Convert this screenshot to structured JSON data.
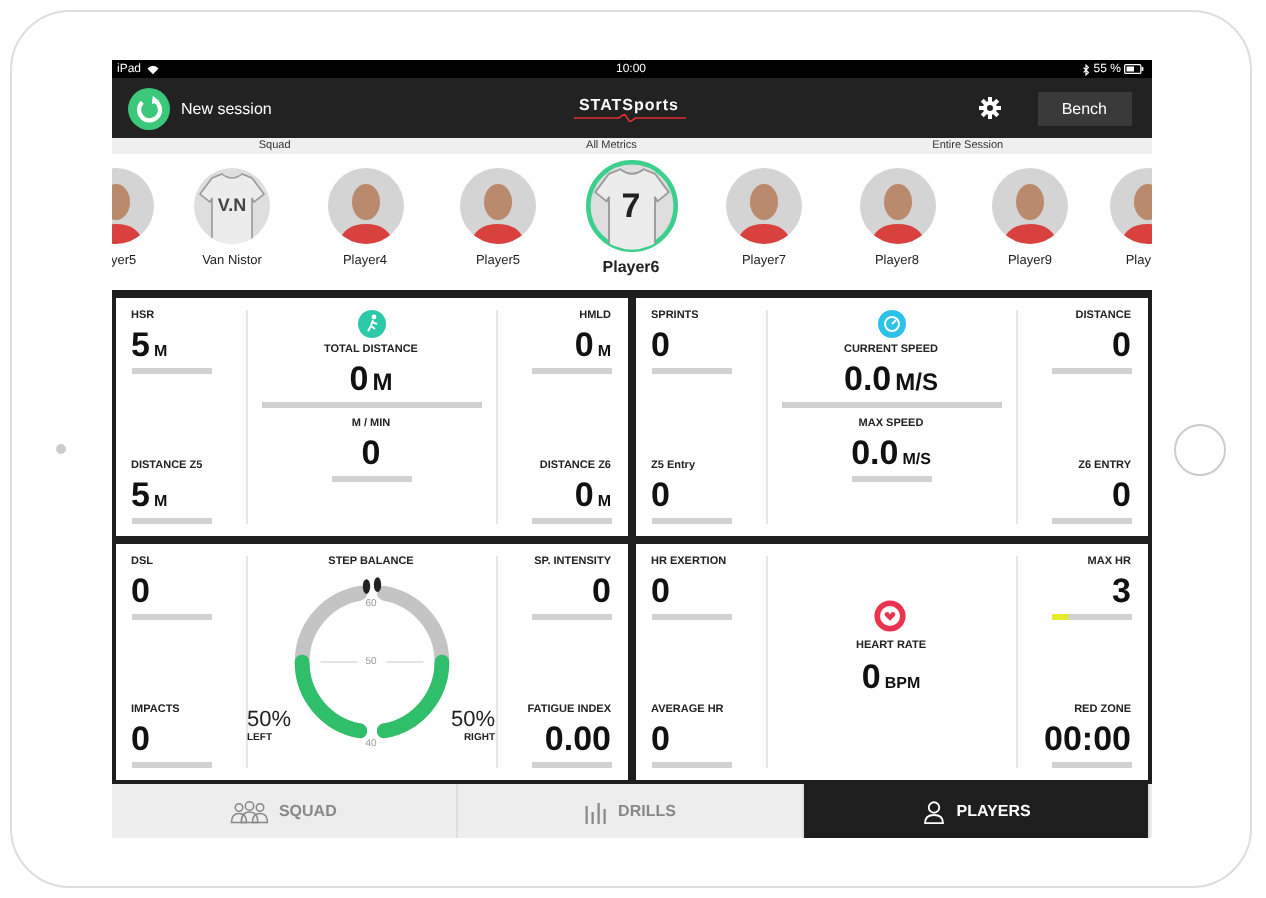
{
  "status_bar": {
    "device": "iPad",
    "time": "10:00",
    "battery": "55 %"
  },
  "header": {
    "new_session": "New session",
    "logo": "STATSports",
    "bench": "Bench"
  },
  "filters": [
    "Squad",
    "All Metrics",
    "Entire Session"
  ],
  "players": [
    {
      "name": "yer5",
      "kind": "photo",
      "selected": false
    },
    {
      "name": "Van Nistor",
      "kind": "jersey",
      "jersey_text": "V.N",
      "selected": false
    },
    {
      "name": "Player4",
      "kind": "photo",
      "selected": false
    },
    {
      "name": "Player5",
      "kind": "photo",
      "selected": false
    },
    {
      "name": "Player6",
      "kind": "jersey",
      "jersey_text": "7",
      "selected": true
    },
    {
      "name": "Player7",
      "kind": "photo",
      "selected": false
    },
    {
      "name": "Player8",
      "kind": "photo",
      "selected": false
    },
    {
      "name": "Player9",
      "kind": "photo",
      "selected": false
    },
    {
      "name": "Play",
      "kind": "photo",
      "selected": false
    }
  ],
  "panels": [
    {
      "left": [
        {
          "label": "HSR",
          "value": "5",
          "unit": "M",
          "level": 0
        },
        {
          "label": "DISTANCE Z5",
          "value": "5",
          "unit": "M",
          "level": 0
        }
      ],
      "center": {
        "kind": "distance",
        "primary": {
          "label": "TOTAL DISTANCE",
          "value": "0",
          "unit": "M",
          "level": 0
        },
        "secondary": {
          "label": "M / MIN",
          "value": "0",
          "level": 0
        }
      },
      "right": [
        {
          "label": "HMLD",
          "value": "0",
          "unit": "M",
          "level": 0
        },
        {
          "label": "DISTANCE Z6",
          "value": "0",
          "unit": "M",
          "level": 0
        }
      ]
    },
    {
      "left": [
        {
          "label": "SPRINTS",
          "value": "0",
          "level": 0
        },
        {
          "label": "Z5 Entry",
          "value": "0",
          "level": 0
        }
      ],
      "center": {
        "kind": "speed",
        "primary": {
          "label": "CURRENT SPEED",
          "value": "0.0",
          "unit": "M/S",
          "level": 0
        },
        "secondary": {
          "label": "MAX SPEED",
          "value": "0.0",
          "unit": "M/S",
          "level": 0
        }
      },
      "right": [
        {
          "label": "DISTANCE",
          "value": "0",
          "level": 0
        },
        {
          "label": "Z6 ENTRY",
          "value": "0",
          "level": 0
        }
      ]
    },
    {
      "left": [
        {
          "label": "DSL",
          "value": "0",
          "level": 0
        },
        {
          "label": "IMPACTS",
          "value": "0",
          "level": 0
        }
      ],
      "center": {
        "kind": "step_balance",
        "title": "STEP BALANCE",
        "scale": [
          "60",
          "50",
          "40"
        ],
        "left": {
          "value": "50%",
          "label": "LEFT",
          "level": 0.5
        },
        "right": {
          "value": "50%",
          "label": "RIGHT",
          "level": 0.5
        }
      },
      "right": [
        {
          "label": "SP. INTENSITY",
          "value": "0",
          "level": 0
        },
        {
          "label": "FATIGUE INDEX",
          "value": "0.00",
          "level": 0
        }
      ]
    },
    {
      "left": [
        {
          "label": "HR EXERTION",
          "value": "0",
          "level": 0
        },
        {
          "label": "AVERAGE HR",
          "value": "0",
          "level": 0
        }
      ],
      "center": {
        "kind": "heart_rate",
        "primary": {
          "label": "HEART RATE",
          "value": "0",
          "unit": "BPM"
        }
      },
      "right": [
        {
          "label": "MAX HR",
          "value": "3",
          "level": 0.2
        },
        {
          "label": "RED ZONE",
          "value": "00:00",
          "level": 0
        }
      ]
    }
  ],
  "tabs": [
    {
      "label": "SQUAD",
      "kind": "squad",
      "selected": false
    },
    {
      "label": "DRILLS",
      "kind": "drills",
      "selected": false
    },
    {
      "label": "PLAYERS",
      "kind": "players",
      "selected": true
    }
  ]
}
